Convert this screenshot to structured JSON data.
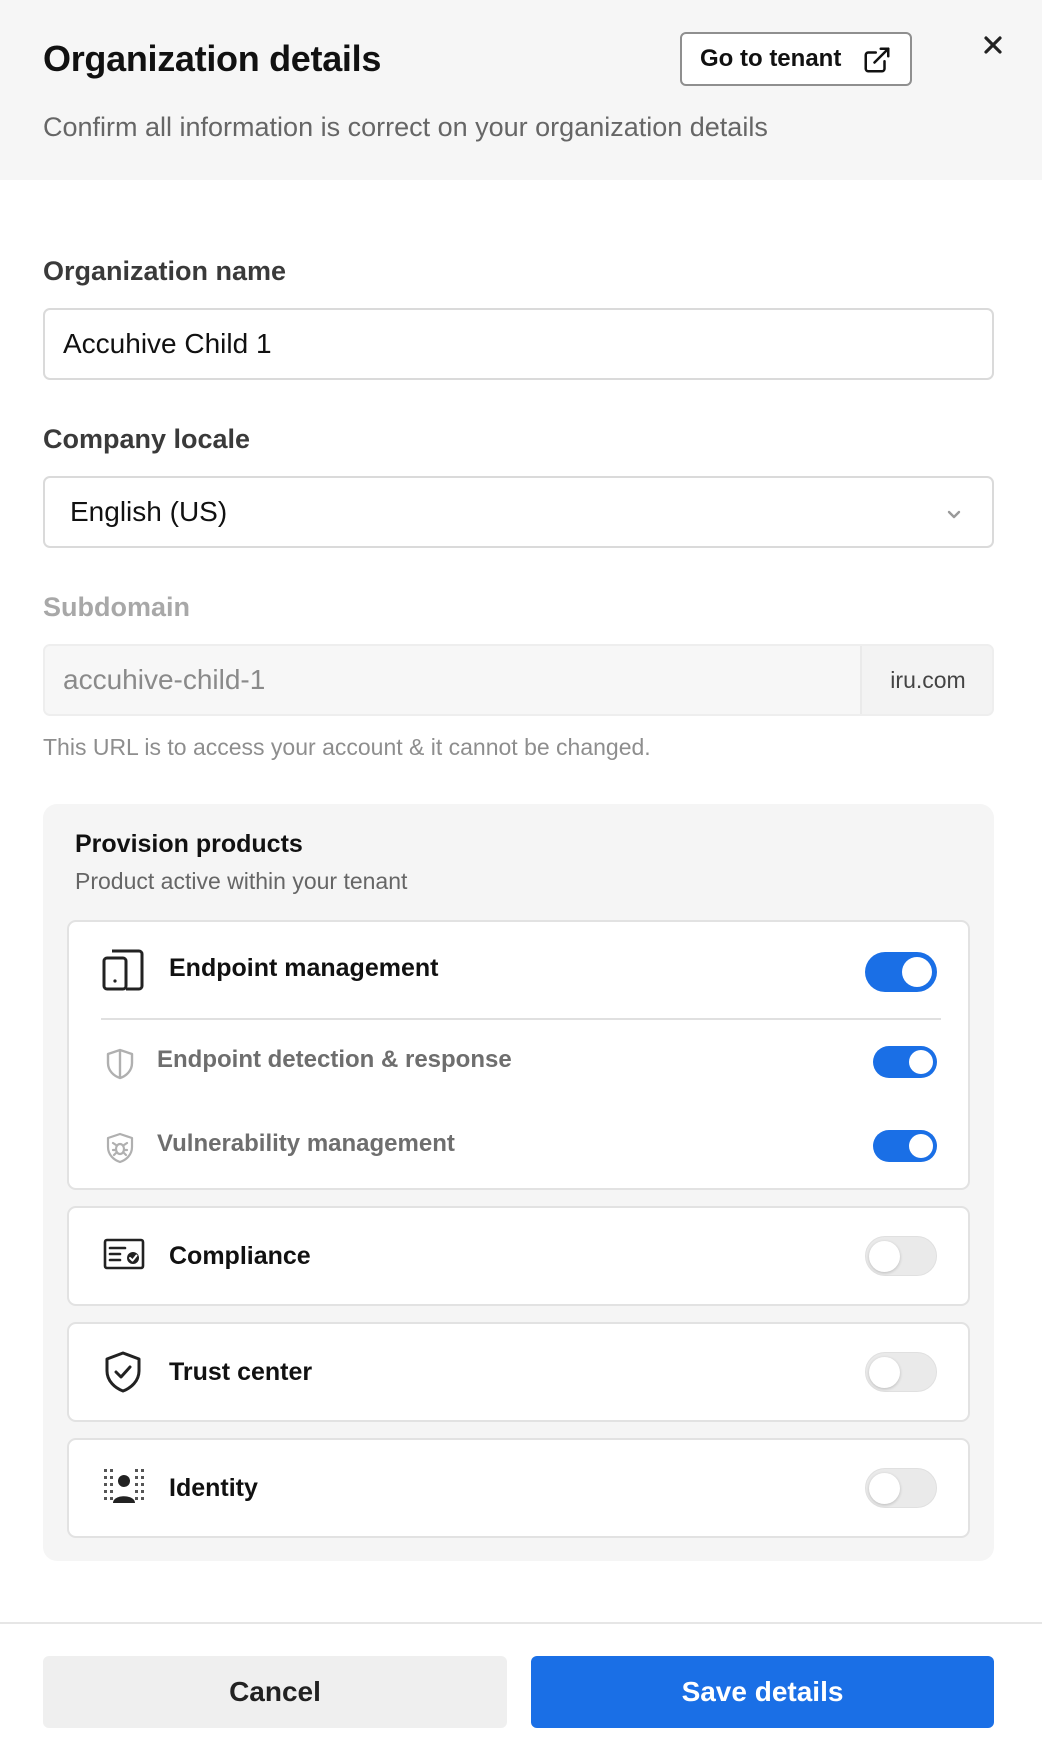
{
  "dialog": {
    "title": "Organization details",
    "subtitle": "Confirm all information is correct on your organization details",
    "go_to_tenant_label": "Go to tenant"
  },
  "form": {
    "org_name_label": "Organization name",
    "org_name_value": "Accuhive Child 1",
    "locale_label": "Company locale",
    "locale_value": "English (US)",
    "subdomain_label": "Subdomain",
    "subdomain_value": "accuhive-child-1",
    "subdomain_suffix": "iru.com",
    "subdomain_hint": "This URL is to access your account & it cannot be changed."
  },
  "provision": {
    "title": "Provision products",
    "subtitle": "Product active within your tenant",
    "products": [
      {
        "label": "Endpoint management",
        "icon": "device-icon",
        "enabled": true
      },
      {
        "label": "Endpoint detection & response",
        "icon": "shield-outline-icon",
        "enabled": true
      },
      {
        "label": "Vulnerability management",
        "icon": "shield-bug-icon",
        "enabled": true
      },
      {
        "label": "Compliance",
        "icon": "certificate-icon",
        "enabled": false
      },
      {
        "label": "Trust center",
        "icon": "shield-check-icon",
        "enabled": false
      },
      {
        "label": "Identity",
        "icon": "identity-icon",
        "enabled": false
      }
    ]
  },
  "footer": {
    "cancel_label": "Cancel",
    "save_label": "Save details"
  },
  "colors": {
    "accent": "#1a6fe6",
    "toggle_off": "#eaeaea",
    "header_bg": "#f6f6f6",
    "panel_bg": "#f5f5f5"
  }
}
